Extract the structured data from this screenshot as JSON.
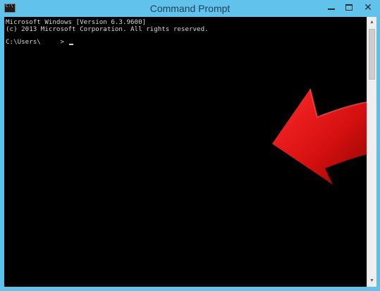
{
  "window": {
    "title": "Command Prompt",
    "icon_label": "C:\\",
    "buttons": {
      "minimize": "minimize-icon",
      "maximize": "maximize-icon",
      "close": "✕"
    },
    "frame_color": "#5bc0ea"
  },
  "console": {
    "lines": [
      "Microsoft Windows [Version 6.3.9600]",
      "(c) 2013 Microsoft Corporation. All rights reserved.",
      "C:\\Users\\     >"
    ],
    "background": "#000000",
    "text_color": "#d6d6d6"
  },
  "annotation": {
    "icon": "red-arrow-icon",
    "color": "#d40f0f"
  },
  "scrollbar": {
    "up": "▲",
    "down": "▼"
  }
}
